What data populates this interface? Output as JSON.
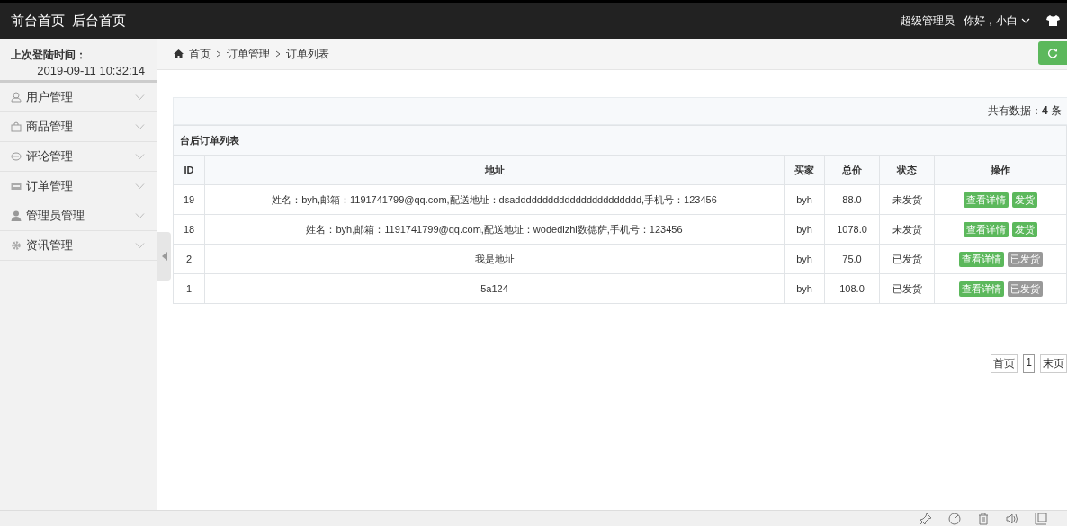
{
  "header": {
    "links": [
      "前台首页",
      "后台首页"
    ],
    "role": "超级管理员",
    "greeting": "你好，小白"
  },
  "sidebar": {
    "login_label": "上次登陆时间：",
    "login_time": "2019-09-11 10:32:14",
    "items": [
      {
        "label": "用户管理",
        "expanded": false
      },
      {
        "label": "商品管理",
        "expanded": false
      },
      {
        "label": "评论管理",
        "expanded": false
      },
      {
        "label": "订单管理",
        "expanded": false
      },
      {
        "label": "管理员管理",
        "expanded": false
      },
      {
        "label": "资讯管理",
        "expanded": false
      }
    ]
  },
  "breadcrumb": [
    "首页",
    "订单管理",
    "订单列表"
  ],
  "summary": {
    "label": "共有数据：",
    "count": "4",
    "unit": "条"
  },
  "table": {
    "title": "台后订单列表",
    "columns": [
      "ID",
      "地址",
      "买家",
      "总价",
      "状态",
      "操作"
    ],
    "rows": [
      {
        "id": "19",
        "address": "姓名：byh,邮箱：1191741799@qq.com,配送地址：dsaddddddddddddddddddddddd,手机号：123456",
        "buyer": "byh",
        "total": "88.0",
        "status": "未发货",
        "actions": [
          {
            "label": "查看详情",
            "kind": "view"
          },
          {
            "label": "发货",
            "kind": "ship"
          }
        ]
      },
      {
        "id": "18",
        "address": "姓名：byh,邮箱：1191741799@qq.com,配送地址：wodedizhi数德萨,手机号：123456",
        "buyer": "byh",
        "total": "1078.0",
        "status": "未发货",
        "actions": [
          {
            "label": "查看详情",
            "kind": "view"
          },
          {
            "label": "发货",
            "kind": "ship"
          }
        ]
      },
      {
        "id": "2",
        "address": "我是地址",
        "buyer": "byh",
        "total": "75.0",
        "status": "已发货",
        "actions": [
          {
            "label": "查看详情",
            "kind": "view"
          },
          {
            "label": "已发货",
            "kind": "shipped"
          }
        ]
      },
      {
        "id": "1",
        "address": "5a124",
        "buyer": "byh",
        "total": "108.0",
        "status": "已发货",
        "actions": [
          {
            "label": "查看详情",
            "kind": "view"
          },
          {
            "label": "已发货",
            "kind": "shipped"
          }
        ]
      }
    ]
  },
  "pagination": [
    {
      "label": "首页",
      "selected": false
    },
    {
      "label": "1",
      "selected": true
    },
    {
      "label": "末页",
      "selected": false
    }
  ]
}
